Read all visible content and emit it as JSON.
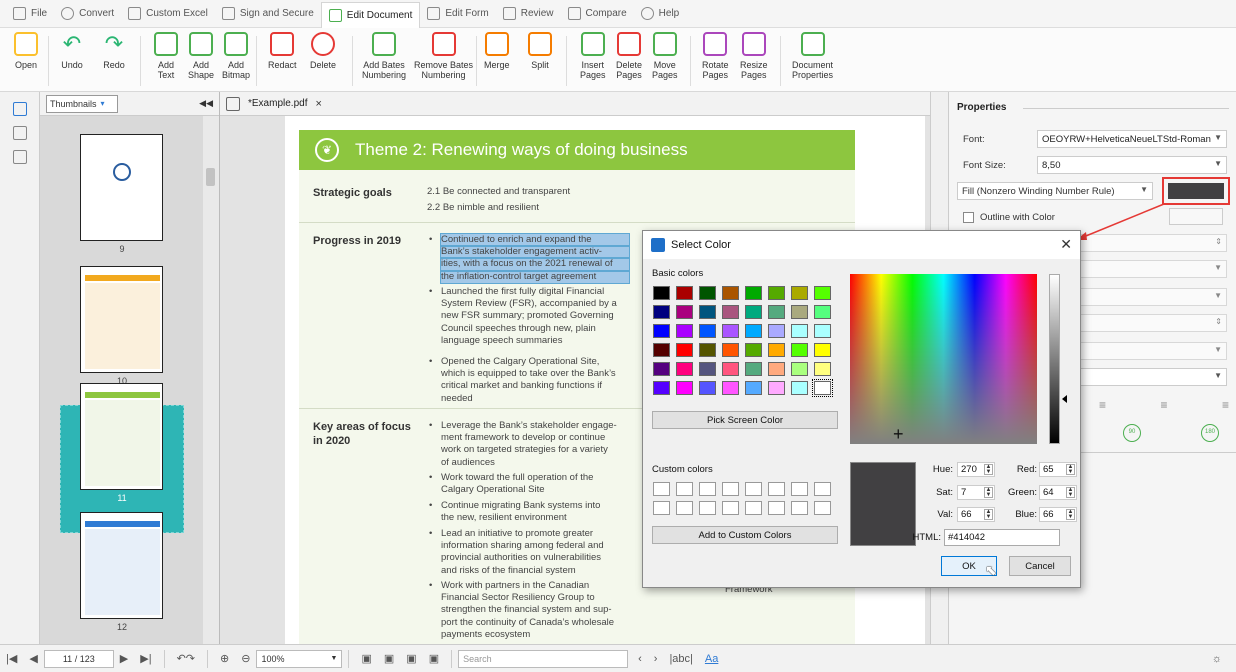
{
  "menu": {
    "tabs": [
      {
        "label": "File",
        "icon": "file-icon"
      },
      {
        "label": "Convert",
        "icon": "convert-icon"
      },
      {
        "label": "Custom Excel",
        "icon": "table-icon"
      },
      {
        "label": "Sign and Secure",
        "icon": "pen-icon"
      },
      {
        "label": "Edit Document",
        "icon": "edit-document-icon"
      },
      {
        "label": "Edit Form",
        "icon": "form-icon"
      },
      {
        "label": "Review",
        "icon": "review-icon"
      },
      {
        "label": "Compare",
        "icon": "compare-icon"
      },
      {
        "label": "Help",
        "icon": "help-icon"
      }
    ],
    "active": "Edit Document"
  },
  "ribbon": {
    "open": "Open",
    "undo": "Undo",
    "redo": "Redo",
    "add_text_1": "Add",
    "add_text_2": "Text",
    "add_shape_1": "Add",
    "add_shape_2": "Shape",
    "add_bitmap_1": "Add",
    "add_bitmap_2": "Bitmap",
    "redact": "Redact",
    "delete": "Delete",
    "add_bates_1": "Add Bates",
    "add_bates_2": "Numbering",
    "remove_bates_1": "Remove Bates",
    "remove_bates_2": "Numbering",
    "merge": "Merge",
    "split": "Split",
    "insert_pages_1": "Insert",
    "insert_pages_2": "Pages",
    "delete_pages_1": "Delete",
    "delete_pages_2": "Pages",
    "move_pages_1": "Move",
    "move_pages_2": "Pages",
    "rotate_pages_1": "Rotate",
    "rotate_pages_2": "Pages",
    "resize_pages_1": "Resize",
    "resize_pages_2": "Pages",
    "doc_props_1": "Document",
    "doc_props_2": "Properties"
  },
  "thumbnails": {
    "selector": "Thumbnails",
    "pages": [
      "9",
      "10",
      "11",
      "12"
    ],
    "selected": "11"
  },
  "document": {
    "tab": "*Example.pdf",
    "banner_icon": "leaf-icon",
    "title": "Theme 2: Renewing ways of doing business",
    "rows": {
      "strategic_label": "Strategic goals",
      "strategic_1": "2.1 Be connected and transparent",
      "strategic_2": "2.2 Be nimble and resilient",
      "progress_label": "Progress in 2019",
      "progress_b1": [
        "Continued to enrich and expand the",
        "Bank’s stakeholder engagement activ-",
        "ities, with a focus on the 2021 renewal of",
        "the inflation-control target agreement"
      ],
      "progress_b2": [
        "Launched the first fully digital Financial",
        "System Review (FSR), accompanied by a",
        "new FSR summary; promoted Governing",
        "Council speeches through new, plain",
        "language speech summaries"
      ],
      "progress_b3": [
        "Opened the Calgary Operational Site,",
        "which is equipped to take over the Bank’s",
        "critical market and banking functions if",
        "needed"
      ],
      "focus_label_1": "Key areas of focus",
      "focus_label_2": "in 2020",
      "focus_b1": [
        "Leverage the Bank’s stakeholder engage-",
        "ment framework to develop or continue",
        "work on targeted strategies for a variety",
        "of audiences"
      ],
      "focus_b2": [
        "Work toward the full operation of the",
        "Calgary Operational Site"
      ],
      "focus_b3": [
        "Continue migrating Bank systems into",
        "the new, resilient environment"
      ],
      "focus_b4": [
        "Lead an initiative to promote greater",
        "information sharing among federal and",
        "provincial authorities on vulnerabilities",
        "and risks of the financial system"
      ],
      "focus_b5": [
        "Work with partners in the Canadian",
        "Financial Sector Resiliency Group to",
        "strengthen the financial system and sup-",
        "port the continuity of Canada’s wholesale",
        "payments ecosystem"
      ],
      "framework": "Framework"
    }
  },
  "properties": {
    "header": "Properties",
    "font_label": "Font:",
    "font_value": "OEOYRW+HelveticaNeueLTStd-Roman",
    "size_label": "Font Size:",
    "size_value": "8,50",
    "fill_rule": "Fill (Nonzero Winding Number Rule)",
    "fill_color": "#414042",
    "outline_label": "Outline with Color",
    "rotate_90": "90",
    "rotate_180": "180"
  },
  "dialog": {
    "title": "Select Color",
    "basic_label": "Basic colors",
    "basic_colors": [
      "#000000",
      "#aa0000",
      "#005500",
      "#aa5500",
      "#00aa00",
      "#55aa00",
      "#aaaa00",
      "#55ff00",
      "#00007f",
      "#aa007f",
      "#00557f",
      "#aa557f",
      "#00aa7f",
      "#55aa7f",
      "#aaaa7f",
      "#55ff7f",
      "#0000ff",
      "#aa00ff",
      "#0055ff",
      "#aa55ff",
      "#00aaff",
      "#aaaaff",
      "#aaffff",
      "#aaffff",
      "#550000",
      "#ff0000",
      "#555500",
      "#ff5500",
      "#55aa00",
      "#ffaa00",
      "#55ff00",
      "#ffff00",
      "#55007f",
      "#ff007f",
      "#55557f",
      "#ff557f",
      "#55aa7f",
      "#ffaa7f",
      "#aaff7f",
      "#ffff7f",
      "#5500ff",
      "#ff00ff",
      "#5555ff",
      "#ff55ff",
      "#55aaff",
      "#ffaaff",
      "#aaffff",
      "#ffffff"
    ],
    "pick_screen": "Pick Screen Color",
    "custom_label": "Custom colors",
    "add_custom": "Add to Custom Colors",
    "hue_label": "Hue:",
    "hue": "270",
    "sat_label": "Sat:",
    "sat": "7",
    "val_label": "Val:",
    "val": "66",
    "red_label": "Red:",
    "red": "65",
    "green_label": "Green:",
    "green": "64",
    "blue_label": "Blue:",
    "blue": "66",
    "html_label": "HTML:",
    "html": "#414042",
    "ok": "OK",
    "cancel": "Cancel",
    "preview_color": "#414042"
  },
  "status": {
    "page_current": "11",
    "page_sep": "/",
    "page_total": "123",
    "zoom": "100%",
    "search_placeholder": "Search"
  }
}
